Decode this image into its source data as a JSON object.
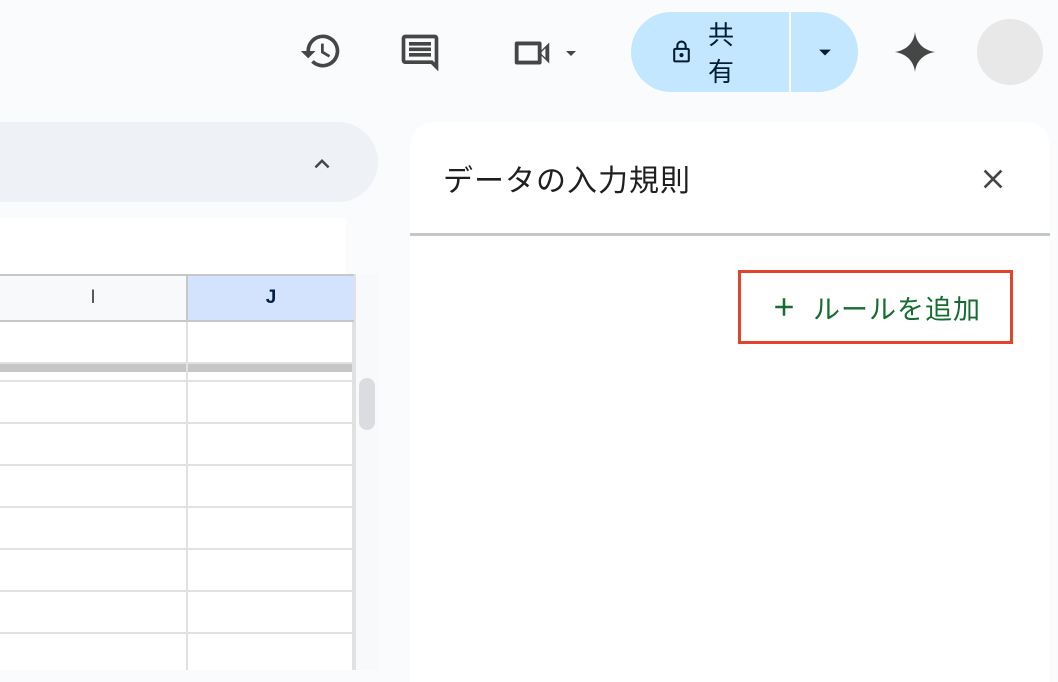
{
  "topbar": {
    "history_icon": "history-icon",
    "comment_icon": "comment-icon",
    "meet_icon": "video-camera-icon",
    "share_label": "共有",
    "share_icon": "lock-icon",
    "gemini_icon": "sparkle-icon"
  },
  "grid": {
    "columns": [
      {
        "label": "I",
        "selected": false
      },
      {
        "label": "J",
        "selected": true
      }
    ]
  },
  "panel": {
    "title": "データの入力規則",
    "add_rule_label": "ルールを追加"
  },
  "colors": {
    "share_bg": "#c2e7ff",
    "accent_green": "#146c2e",
    "highlight_border": "#e0442a",
    "selected_col_bg": "#d3e3fd"
  }
}
